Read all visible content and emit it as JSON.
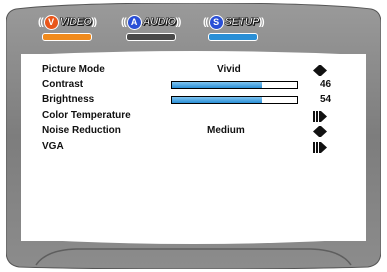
{
  "tabs": [
    {
      "label": "VIDEO",
      "icon_letter": "V",
      "icon_color": "#e8561a",
      "underline_color": "#f08a1c",
      "active": true
    },
    {
      "label": "AUDIO",
      "icon_letter": "A",
      "icon_color": "#2a4fd6",
      "underline_color": "#4a4a4a",
      "active": false
    },
    {
      "label": "SETUP",
      "icon_letter": "S",
      "icon_color": "#2a4fd6",
      "underline_color": "#2a8fd6",
      "active": false
    }
  ],
  "settings": [
    {
      "name": "Picture Mode",
      "value": "Vivid",
      "control": "left-right-arrow-icon"
    },
    {
      "name": "Contrast",
      "value": "46",
      "level": 0.72,
      "control": "none"
    },
    {
      "name": "Brightness",
      "value": "54",
      "level": 0.72,
      "control": "none"
    },
    {
      "name": "Color Temperature",
      "value": "",
      "control": "submenu-arrow-icon"
    },
    {
      "name": "Noise Reduction",
      "value": "Medium",
      "control": "left-right-arrow-icon"
    },
    {
      "name": "VGA",
      "value": "",
      "control": "submenu-arrow-icon"
    }
  ],
  "colors": {
    "frame": "#8a8a8a",
    "frame_dark": "#6b6b6b",
    "panel": "#ffffff",
    "bar_fill": "#2a8fd6"
  }
}
